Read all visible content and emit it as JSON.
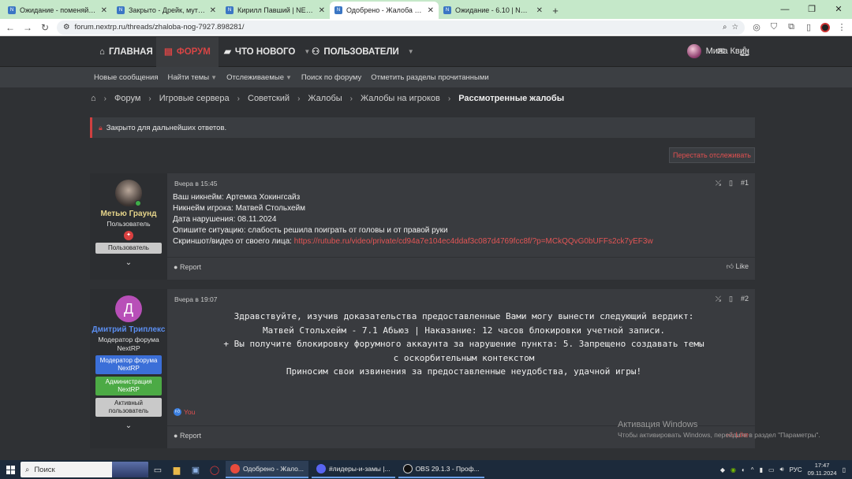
{
  "browser": {
    "tabs": [
      {
        "title": "Ожидание - поменяйте ник п...",
        "active": false
      },
      {
        "title": "Закрыто - Дрейк, мут без при...",
        "active": false
      },
      {
        "title": "Кирилл Павший | NEXTRP",
        "active": false
      },
      {
        "title": "Одобрено - Жалоба №G-7927...",
        "active": true
      },
      {
        "title": "Ожидание - 6.10 | NEXTRP",
        "active": false
      }
    ],
    "url": "forum.nextrp.ru/threads/zhaloba-nog-7927.898281/"
  },
  "topnav": {
    "home": "ГЛАВНАЯ",
    "forum": "ФОРУМ",
    "whats_new": "ЧТО НОВОГО",
    "users": "ПОЛЬЗОВАТЕЛИ",
    "current_user": "Мила Квин"
  },
  "subnav": {
    "new_posts": "Новые сообщения",
    "find_threads": "Найти темы",
    "watched": "Отслеживаемые",
    "search_forums": "Поиск по форуму",
    "mark_read": "Отметить разделы прочитанными"
  },
  "breadcrumb": [
    "Форум",
    "Игровые сервера",
    "Советский",
    "Жалобы",
    "Жалобы на игроков",
    "Рассмотренные жалобы"
  ],
  "notice": "Закрыто для дальнейших ответов.",
  "unwatch_button": "Перестать отслеживать",
  "posts": [
    {
      "author": "Метью Граунд",
      "author_color": "#e5d48a",
      "user_title": "Пользователь",
      "banners": [
        "Пользователь"
      ],
      "time": "Вчера в 15:45",
      "number": "#1",
      "lines": [
        "Ваш никнейм: Артемка Хокингсайз",
        "Никнейм игрока: Матвей Стольхейм",
        "Дата нарушения: 08.11.2024",
        "Опишите ситуацию: слабость решила поиграть от головы и от правой руки",
        "Скриншот/видео от своего лица:"
      ],
      "link": "https://rutube.ru/video/private/cd94a7e104ec4ddaf3c087d4769fcc8f/?p=MCkQQvG0bUFFs2ck7yEF3w",
      "report": "Report",
      "like": "Like"
    },
    {
      "author": "Дмитрий Триплекс",
      "author_color": "#5b8ef0",
      "avatar_letter": "Д",
      "user_title": "Модератор форума NextRP",
      "banners": [
        "Модератор форума NextRP",
        "Администрация NextRP",
        "Активный пользователь"
      ],
      "time": "Вчера в 19:07",
      "number": "#2",
      "verdict_lines": [
        "Здравствуйте, изучив доказательства предоставленные Вами могу вынести следующий вердикт:",
        "Матвей Стольхейм - 7.1 Абьюз | Наказание: 12 часов блокировки учетной записи.",
        "+ Вы получите блокировку форумного аккаунта за нарушение пункта: 5. Запрещено создавать темы",
        "с оскорбительным контекстом",
        "Приносим свои извинения за предоставленные неудобства, удачной игры!"
      ],
      "reaction_by": "You",
      "report": "Report",
      "like": "Like"
    }
  ],
  "watermark": {
    "title": "Активация Windows",
    "subtitle": "Чтобы активировать Windows, перейдите в раздел \"Параметры\"."
  },
  "taskbar": {
    "search": "Поиск",
    "apps": [
      {
        "label": "Одобрено - Жало...",
        "active": true,
        "color": "#e84c3d"
      },
      {
        "label": "#лидеры-и-замы |...",
        "active": false,
        "color": "#5865f2"
      },
      {
        "label": "OBS 29.1.3 - Проф...",
        "active": false,
        "color": "#111111"
      }
    ],
    "lang": "РУС",
    "time": "17:47",
    "date": "09.11.2024"
  }
}
